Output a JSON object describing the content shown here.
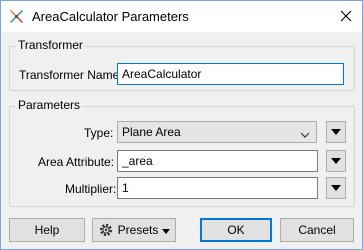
{
  "window": {
    "title": "AreaCalculator Parameters",
    "app_icon": "fme-transformer-icon",
    "close_icon": "close-icon"
  },
  "transformer_group": {
    "title": "Transformer",
    "name_label": "Transformer Name:",
    "name_value": "AreaCalculator"
  },
  "parameters_group": {
    "title": "Parameters",
    "type_label": "Type:",
    "type_value": "Plane Area",
    "area_label": "Area Attribute:",
    "area_value": "_area",
    "multiplier_label": "Multiplier:",
    "multiplier_value": "1"
  },
  "buttons": {
    "help": "Help",
    "presets": "Presets",
    "ok": "OK",
    "cancel": "Cancel"
  },
  "colors": {
    "accent": "#0078d7",
    "background": "#f0f0f0",
    "border": "#adadad"
  }
}
